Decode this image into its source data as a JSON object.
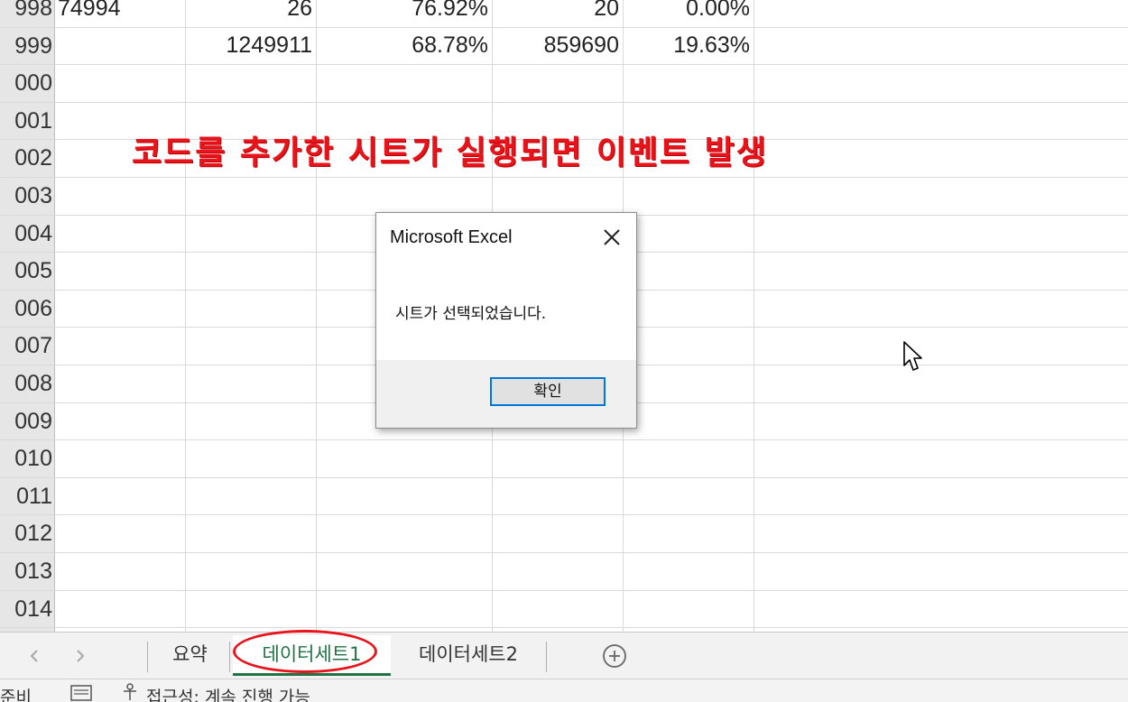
{
  "sheet": {
    "row_headers": [
      "998",
      "999",
      "000",
      "001",
      "002",
      "003",
      "004",
      "005",
      "006",
      "007",
      "008",
      "009",
      "010",
      "011",
      "012",
      "013",
      "014"
    ],
    "row_998": {
      "b": "74994",
      "c": "26",
      "d": "76.92%",
      "e": "20",
      "f": "0.00%"
    },
    "row_999": {
      "c": "1249911",
      "d": "68.78%",
      "e": "859690",
      "f": "19.63%"
    }
  },
  "annotation": {
    "text": "코드를 추가한 시트가 실행되면 이벤트 발생",
    "color": "#e8131b"
  },
  "dialog": {
    "title": "Microsoft Excel",
    "close_icon": "close-x",
    "message": "시트가 선택되었습니다.",
    "ok_label": "확인"
  },
  "tabs": {
    "items": [
      {
        "label": "요약"
      },
      {
        "label": "데이터세트1",
        "active": true
      },
      {
        "label": "데이터세트2"
      }
    ],
    "add_icon": "plus-circle",
    "accent": "#217346"
  },
  "status": {
    "ready": "준비",
    "accessibility": "접근성: 계속 진행 가능"
  }
}
